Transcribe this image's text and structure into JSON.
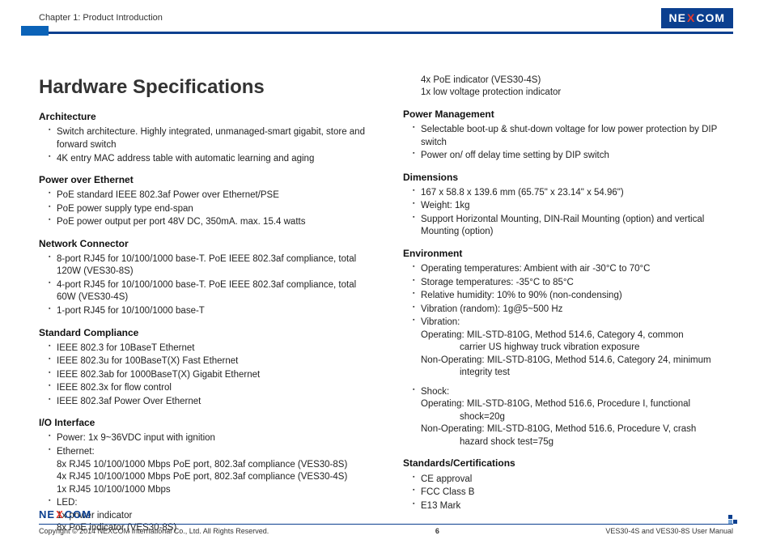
{
  "header": {
    "chapter": "Chapter 1: Product Introduction",
    "logo": {
      "left": "NE",
      "mid": "X",
      "right": "COM"
    }
  },
  "title": "Hardware Specifications",
  "left": {
    "architecture": {
      "heading": "Architecture",
      "items": [
        "Switch architecture. Highly integrated, unmanaged-smart gigabit, store and forward switch",
        "4K entry MAC address table with automatic learning and aging"
      ]
    },
    "poe": {
      "heading": "Power over Ethernet",
      "items": [
        "PoE standard IEEE 802.3af Power over Ethernet/PSE",
        "PoE power supply type end-span",
        "PoE power output per port 48V DC, 350mA. max. 15.4 watts"
      ]
    },
    "network": {
      "heading": "Network Connector",
      "items": [
        "8-port RJ45 for 10/100/1000 base-T. PoE IEEE 802.3af compliance, total 120W (VES30-8S)",
        "4-port RJ45 for 10/100/1000 base-T. PoE IEEE 802.3af compliance, total 60W (VES30-4S)",
        "1-port RJ45 for 10/100/1000 base-T"
      ]
    },
    "compliance": {
      "heading": "Standard Compliance",
      "items": [
        "IEEE 802.3 for 10BaseT Ethernet",
        "IEEE 802.3u for 100BaseT(X) Fast Ethernet",
        "IEEE 802.3ab for 1000BaseT(X) Gigabit Ethernet",
        "IEEE 802.3x for flow control",
        "IEEE 802.3af Power Over Ethernet"
      ]
    },
    "io": {
      "heading": "I/O Interface",
      "power": "Power: 1x 9~36VDC input with ignition",
      "eth_label": "Ethernet:",
      "eth1": "8x RJ45 10/100/1000 Mbps PoE port, 802.3af compliance (VES30-8S)",
      "eth2": "4x RJ45 10/100/1000 Mbps PoE port, 802.3af compliance (VES30-4S)",
      "eth3": "1x RJ45 10/100/1000 Mbps",
      "led_label": "LED:",
      "led1": "1x power indicator",
      "led2": "8x PoE indicator (VES30-8S)"
    }
  },
  "right": {
    "lead1": "4x PoE indicator (VES30-4S)",
    "lead2": "1x low voltage protection indicator",
    "pm": {
      "heading": "Power Management",
      "items": [
        "Selectable boot-up & shut-down voltage for low power protection by DIP switch",
        "Power on/ off delay time setting by DIP switch"
      ]
    },
    "dim": {
      "heading": "Dimensions",
      "items": [
        "167 x 58.8 x 139.6 mm (65.75\" x 23.14\" x 54.96\")",
        "Weight: 1kg",
        "Support Horizontal Mounting, DIN-Rail Mounting (option) and vertical Mounting (option)"
      ]
    },
    "env": {
      "heading": "Environment",
      "op_temp": "Operating temperatures: Ambient with air -30°C to 70°C",
      "st_temp": "Storage temperatures: -35°C to 85°C",
      "humidity": "Relative humidity: 10% to 90% (non-condensing)",
      "vib_rand": "Vibration (random): 1g@5~500 Hz",
      "vib_label": "Vibration:",
      "vib_op": "Operating: MIL-STD-810G, Method 514.6, Category 4, common",
      "vib_op2": "carrier US highway truck vibration exposure",
      "vib_nop": "Non-Operating: MIL-STD-810G, Method 514.6, Category 24, minimum",
      "vib_nop2": "integrity test",
      "shock_label": "Shock:",
      "shock_op": "Operating: MIL-STD-810G, Method 516.6, Procedure I, functional",
      "shock_op2": "shock=20g",
      "shock_nop": "Non-Operating: MIL-STD-810G, Method 516.6, Procedure V, crash",
      "shock_nop2": "hazard shock test=75g"
    },
    "std": {
      "heading": "Standards/Certifications",
      "items": [
        "CE approval",
        "FCC Class B",
        "E13 Mark"
      ]
    }
  },
  "footer": {
    "copyright": "Copyright © 2014 NEXCOM International Co., Ltd. All Rights Reserved.",
    "page": "6",
    "manual": "VES30-4S and VES30-8S User Manual"
  }
}
